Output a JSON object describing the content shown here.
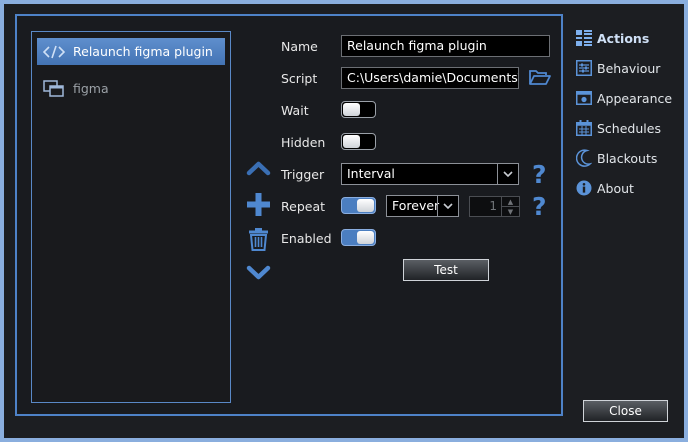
{
  "list": {
    "items": [
      {
        "label": "Relaunch figma plugin",
        "icon": "code-icon",
        "selected": true
      },
      {
        "label": "figma",
        "icon": "windows-group-icon",
        "selected": false
      }
    ]
  },
  "form": {
    "name_label": "Name",
    "name_value": "Relaunch figma plugin",
    "script_label": "Script",
    "script_value": "C:\\Users\\damie\\Documents\\fran",
    "wait_label": "Wait",
    "wait_on": false,
    "hidden_label": "Hidden",
    "hidden_on": false,
    "trigger_label": "Trigger",
    "trigger_value": "Interval",
    "repeat_label": "Repeat",
    "repeat_on": true,
    "repeat_mode": "Forever",
    "repeat_count": "1",
    "enabled_label": "Enabled",
    "enabled_on": true,
    "help_symbol": "?",
    "test_label": "Test"
  },
  "nav": {
    "items": [
      {
        "label": "Actions",
        "icon": "list-icon",
        "active": true
      },
      {
        "label": "Behaviour",
        "icon": "sliders-icon",
        "active": false
      },
      {
        "label": "Appearance",
        "icon": "camera-icon",
        "active": false
      },
      {
        "label": "Schedules",
        "icon": "calendar-icon",
        "active": false
      },
      {
        "label": "Blackouts",
        "icon": "moon-icon",
        "active": false
      },
      {
        "label": "About",
        "icon": "info-icon",
        "active": false
      }
    ]
  },
  "close_label": "Close",
  "colors": {
    "accent": "#4f88d0",
    "selection": "#5587c6",
    "background": "#1c1e22",
    "frame": "#8aaede"
  }
}
